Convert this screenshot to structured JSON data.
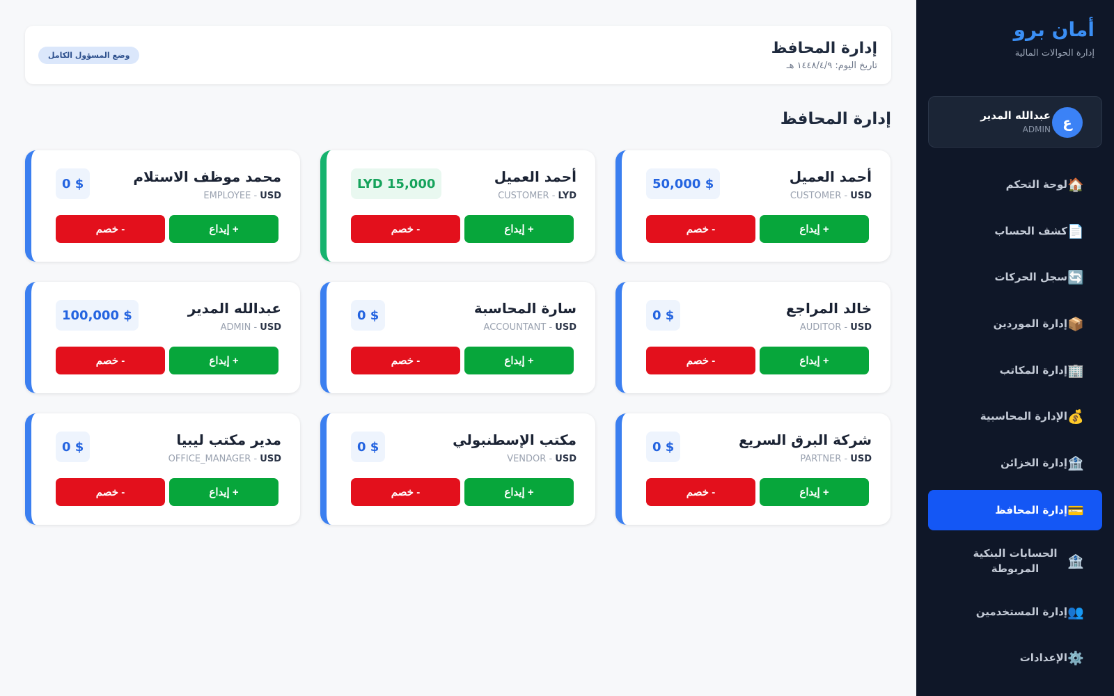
{
  "brand": {
    "title": "أمان برو",
    "subtitle": "إدارة الحوالات المالية"
  },
  "user": {
    "initial": "ع",
    "name": "عبدالله المدير",
    "role": "ADMIN"
  },
  "nav": [
    {
      "icon": "🏠",
      "label": "لوحة التحكم",
      "active": false
    },
    {
      "icon": "📄",
      "label": "كشف الحساب",
      "active": false
    },
    {
      "icon": "🔄",
      "label": "سجل الحركات",
      "active": false
    },
    {
      "icon": "📦",
      "label": "إدارة الموردين",
      "active": false
    },
    {
      "icon": "🏢",
      "label": "إدارة المكاتب",
      "active": false
    },
    {
      "icon": "💰",
      "label": "الإدارة المحاسبية",
      "active": false
    },
    {
      "icon": "🏦",
      "label": "إدارة الخزائن",
      "active": false
    },
    {
      "icon": "💳",
      "label": "إدارة المحافظ",
      "active": true
    },
    {
      "icon": "🏦",
      "label": "الحسابات البنكية المربوطة",
      "active": false
    },
    {
      "icon": "👥",
      "label": "إدارة المستخدمين",
      "active": false
    },
    {
      "icon": "⚙️",
      "label": "الإعدادات",
      "active": false
    }
  ],
  "header": {
    "title": "إدارة المحافظ",
    "date": "تاريخ اليوم: ١٤٤٨/٤/٩ هـ",
    "badge": "وضع المسؤول الكامل"
  },
  "section_title": "إدارة المحافظ",
  "buttons": {
    "deposit": "+ إيداع",
    "withdraw": "- خصم"
  },
  "wallets": [
    {
      "name": "أحمد العميل",
      "role": "CUSTOMER",
      "currency": "USD",
      "balance": "50,000 $",
      "accent": "#3b7ff0"
    },
    {
      "name": "أحمد العميل",
      "role": "CUSTOMER",
      "currency": "LYD",
      "balance": "LYD 15,000",
      "accent": "#16b36e"
    },
    {
      "name": "محمد موظف الاستلام",
      "role": "EMPLOYEE",
      "currency": "USD",
      "balance": "0 $",
      "accent": "#3b7ff0"
    },
    {
      "name": "خالد المراجع",
      "role": "AUDITOR",
      "currency": "USD",
      "balance": "0 $",
      "accent": "#3b7ff0"
    },
    {
      "name": "سارة المحاسبة",
      "role": "ACCOUNTANT",
      "currency": "USD",
      "balance": "0 $",
      "accent": "#3b7ff0"
    },
    {
      "name": "عبدالله المدير",
      "role": "ADMIN",
      "currency": "USD",
      "balance": "100,000 $",
      "accent": "#3b7ff0"
    },
    {
      "name": "شركة البرق السريع",
      "role": "PARTNER",
      "currency": "USD",
      "balance": "0 $",
      "accent": "#3b7ff0"
    },
    {
      "name": "مكتب الإسطنبولي",
      "role": "VENDOR",
      "currency": "USD",
      "balance": "0 $",
      "accent": "#3b7ff0"
    },
    {
      "name": "مدير مكتب ليبيا",
      "role": "OFFICE_MANAGER",
      "currency": "USD",
      "balance": "0 $",
      "accent": "#3b7ff0"
    }
  ],
  "colors": {
    "sidebar_bg": "#0f1728",
    "active_nav": "#1457f5",
    "deposit": "#07a63b",
    "withdraw": "#e3101c",
    "brand": "#3b8ff5"
  }
}
